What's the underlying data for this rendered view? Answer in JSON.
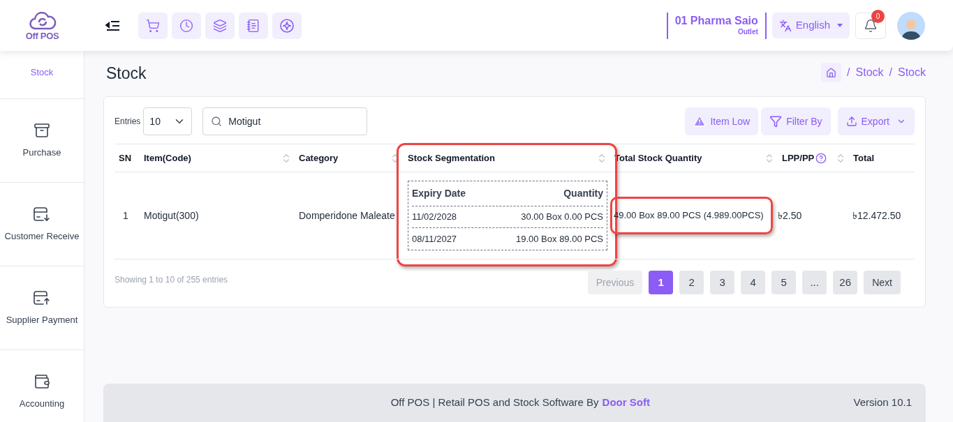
{
  "header": {
    "logo_text": "Off POS",
    "outlet": {
      "name": "01 Pharma Saio",
      "type": "Outlet"
    },
    "language": "English",
    "notifications": "0"
  },
  "sidebar": {
    "items": [
      {
        "label": "Stock",
        "selected": true
      },
      {
        "label": "Purchase",
        "selected": false
      },
      {
        "label": "Customer Receive",
        "selected": false
      },
      {
        "label": "Supplier Payment",
        "selected": false
      },
      {
        "label": "Accounting",
        "selected": false
      }
    ]
  },
  "page": {
    "title": "Stock",
    "breadcrumb": [
      {
        "separator": "/",
        "label": "Stock"
      },
      {
        "separator": "/",
        "label": "Stock"
      }
    ]
  },
  "controls": {
    "entries_label": "Entries",
    "entries_value": "10",
    "search": {
      "value": "Motigut"
    },
    "buttons": [
      {
        "label": "Item Low",
        "kind": "warning"
      },
      {
        "label": "Filter By",
        "kind": "filter"
      },
      {
        "label": "Export",
        "kind": "export"
      }
    ]
  },
  "table": {
    "columns": [
      {
        "label": "SN",
        "sortable": false,
        "help": false
      },
      {
        "label": "Item(Code)",
        "sortable": true,
        "help": false
      },
      {
        "label": "Category",
        "sortable": true,
        "help": false
      },
      {
        "label": "Stock Segmentation",
        "sortable": true,
        "help": false,
        "highlighted": true
      },
      {
        "label": "Total Stock Quantity",
        "sortable": true,
        "help": false
      },
      {
        "label": "LPP/PP",
        "sortable": true,
        "help": true
      },
      {
        "label": "Total",
        "sortable": false,
        "help": false
      }
    ],
    "rows": [
      {
        "sn": "1",
        "item": "Motigut(300)",
        "category": "Domperidone Maleate",
        "segmentation": {
          "columns": [
            "Expiry Date",
            "Quantity"
          ],
          "rows": [
            {
              "date": "11/02/2028",
              "quantity": "30.00 Box 0.00 PCS"
            },
            {
              "date": "08/11/2027",
              "quantity": "19.00 Box 89.00 PCS"
            }
          ]
        },
        "total_quantity": {
          "text": "49.00 Box 89.00 PCS (4.989.00PCS)",
          "highlighted": true
        },
        "lpp": "৳2.50",
        "total": "৳12.472.50"
      }
    ]
  },
  "info": "Showing 1 to 10 of 255 entries",
  "pagination": {
    "previous": {
      "label": "Previous",
      "disabled": true
    },
    "pages": [
      {
        "label": "1",
        "selected": true
      },
      {
        "label": "2",
        "selected": false
      },
      {
        "label": "3",
        "selected": false
      },
      {
        "label": "4",
        "selected": false
      },
      {
        "label": "5",
        "selected": false
      },
      {
        "label": "...",
        "selected": false
      },
      {
        "label": "26",
        "selected": false
      }
    ],
    "next": {
      "label": "Next",
      "disabled": false
    }
  },
  "footer": {
    "text": "Off POS | Retail POS and Stock Software By",
    "link": "Door Soft",
    "version": "Version 10.1"
  }
}
